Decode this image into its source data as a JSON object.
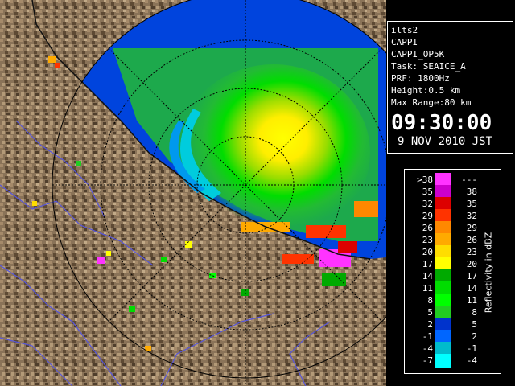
{
  "info": {
    "lines": [
      "ilts2",
      "CAPPI",
      "CAPPI_OP5K",
      "Task: SEAICE_A",
      "PRF: 1800Hz",
      "Height:0.5 km",
      "Max Range:80 km"
    ],
    "time": "09:30:00",
    "date": "9 NOV 2010 JST"
  },
  "legend": {
    "title": "Reflectivity in dBZ",
    "rows": [
      {
        "lo": ">38",
        "hi": "---",
        "color": "#ff33ff"
      },
      {
        "lo": "35",
        "hi": "38",
        "color": "#cc00cc"
      },
      {
        "lo": "32",
        "hi": "35",
        "color": "#dd0000"
      },
      {
        "lo": "29",
        "hi": "32",
        "color": "#ff3300"
      },
      {
        "lo": "26",
        "hi": "29",
        "color": "#ff8800"
      },
      {
        "lo": "23",
        "hi": "26",
        "color": "#ffaa00"
      },
      {
        "lo": "20",
        "hi": "23",
        "color": "#ffdd00"
      },
      {
        "lo": "17",
        "hi": "20",
        "color": "#ffff00"
      },
      {
        "lo": "14",
        "hi": "17",
        "color": "#00aa00"
      },
      {
        "lo": "11",
        "hi": "14",
        "color": "#00dd00"
      },
      {
        "lo": "8",
        "hi": "11",
        "color": "#00ff00"
      },
      {
        "lo": "5",
        "hi": "8",
        "color": "#22cc22"
      },
      {
        "lo": "2",
        "hi": "5",
        "color": "#0033cc"
      },
      {
        "lo": "-1",
        "hi": "2",
        "color": "#0066ff"
      },
      {
        "lo": "-4",
        "hi": "-1",
        "color": "#00bbcc"
      },
      {
        "lo": "-7",
        "hi": "-4",
        "color": "#00ffff"
      }
    ]
  },
  "colors": {
    "background": "#000000",
    "land": "#8a7358",
    "river": "#5555dd",
    "range_ring": "#000000"
  }
}
